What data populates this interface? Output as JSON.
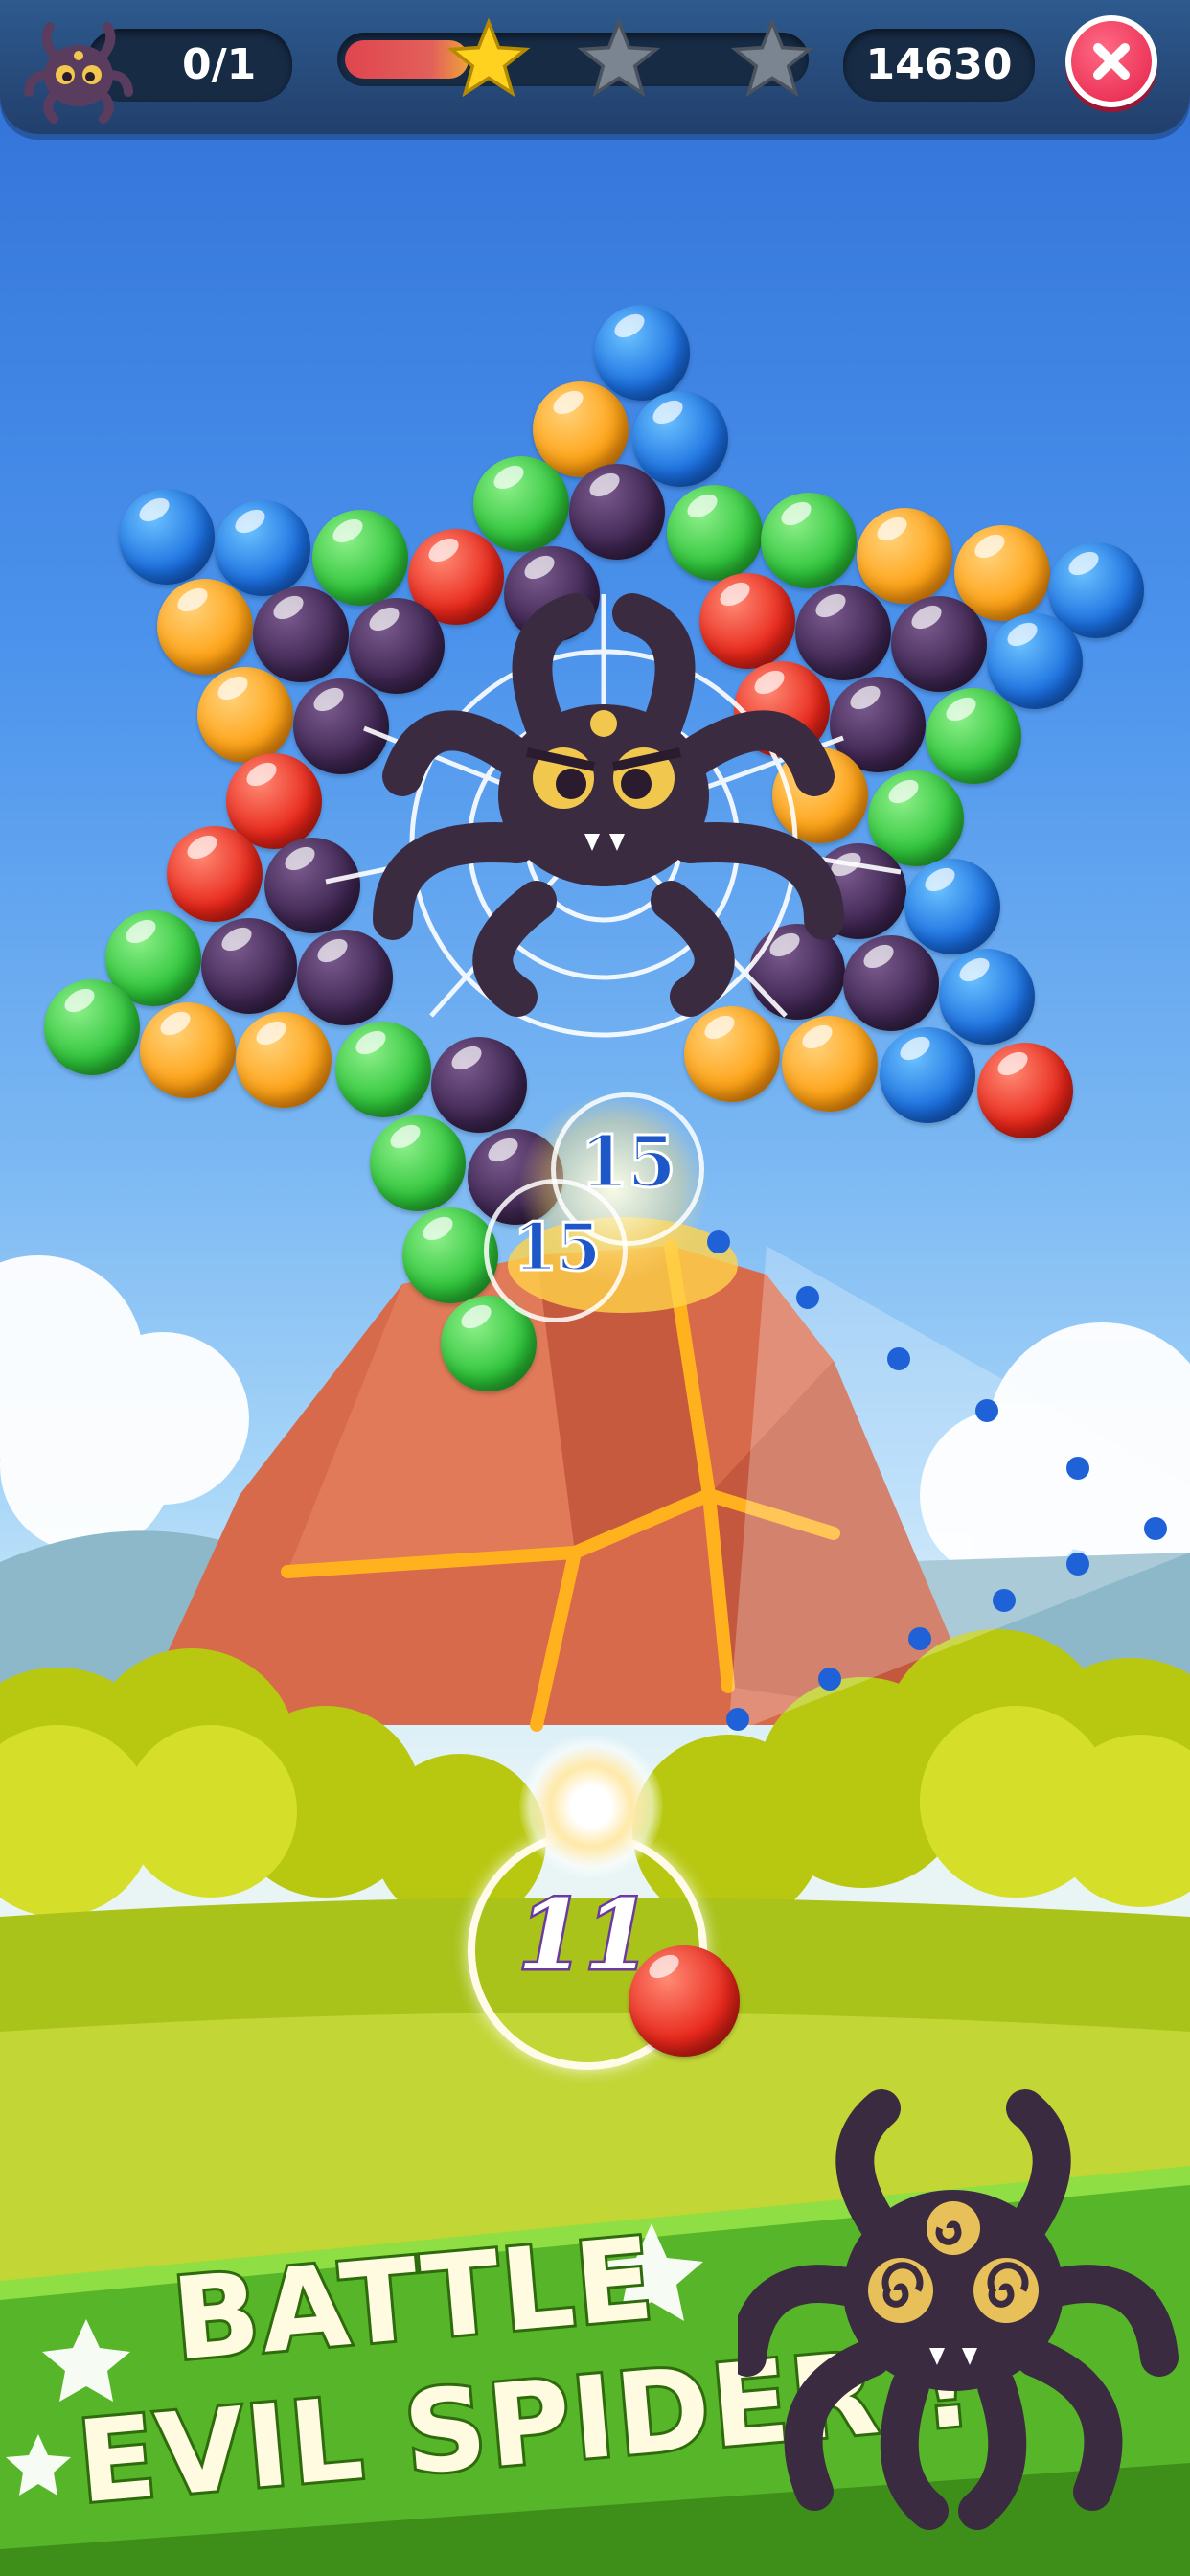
{
  "hud": {
    "moves_text": "0/1",
    "score_text": "14630",
    "progress_fraction": 0.27,
    "stars_earned": 1,
    "stars_total": 3,
    "icons": {
      "avatar": "spider-avatar-icon",
      "close": "close-icon",
      "star": "star-icon"
    }
  },
  "board": {
    "popups": [
      "15",
      "15"
    ],
    "shots_remaining": "11",
    "next_bubble_color": "red"
  },
  "banner": {
    "line1": "BATTLE",
    "line2": "EVIL SPIDER !"
  },
  "colors": {
    "blue": "#1b6fe0",
    "orange": "#ffa214",
    "green": "#2ec43a",
    "red": "#e8261a",
    "purple": "#3d2550",
    "banner_green": "#57b52a",
    "volcano": "#d86a4c"
  }
}
